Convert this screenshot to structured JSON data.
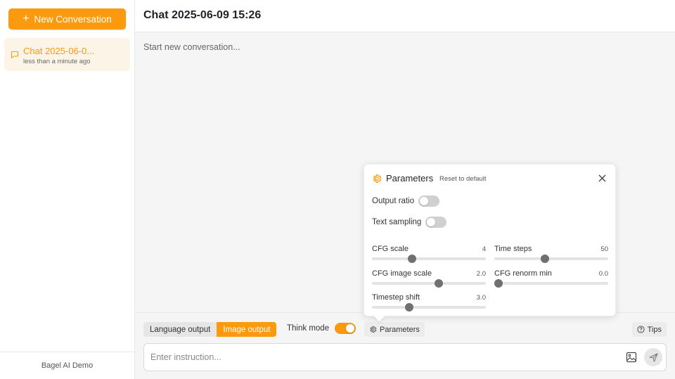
{
  "sidebar": {
    "new_conversation": "New Conversation",
    "conversations": [
      {
        "title": "Chat 2025-06-0...",
        "time": "less than a minute ago"
      }
    ],
    "footer": "Bagel AI Demo"
  },
  "header": {
    "title": "Chat 2025-06-09 15:26"
  },
  "chat": {
    "placeholder": "Start new conversation..."
  },
  "controls": {
    "output_modes": [
      "Language output",
      "Image output"
    ],
    "selected_output": "Image output",
    "think_mode_label": "Think mode",
    "think_mode_on": true,
    "parameters_label": "Parameters",
    "tips_label": "Tips"
  },
  "input": {
    "placeholder": "Enter instruction..."
  },
  "parameters": {
    "title": "Parameters",
    "reset_label": "Reset to default",
    "output_ratio_label": "Output ratio",
    "output_ratio_on": false,
    "text_sampling_label": "Text sampling",
    "text_sampling_on": false,
    "sliders": {
      "cfg_scale": {
        "label": "CFG scale",
        "value": "4",
        "fraction": 0.34
      },
      "time_steps": {
        "label": "Time steps",
        "value": "50",
        "fraction": 0.44
      },
      "cfg_image_scale": {
        "label": "CFG image scale",
        "value": "2.0",
        "fraction": 0.59
      },
      "cfg_renorm_min": {
        "label": "CFG renorm min",
        "value": "0.0",
        "fraction": 0.0
      },
      "timestep_shift": {
        "label": "Timestep shift",
        "value": "3.0",
        "fraction": 0.31
      }
    }
  },
  "colors": {
    "accent": "#fb9a0e",
    "accent_light": "#fdf4e8",
    "background": "#f5f5f5"
  }
}
